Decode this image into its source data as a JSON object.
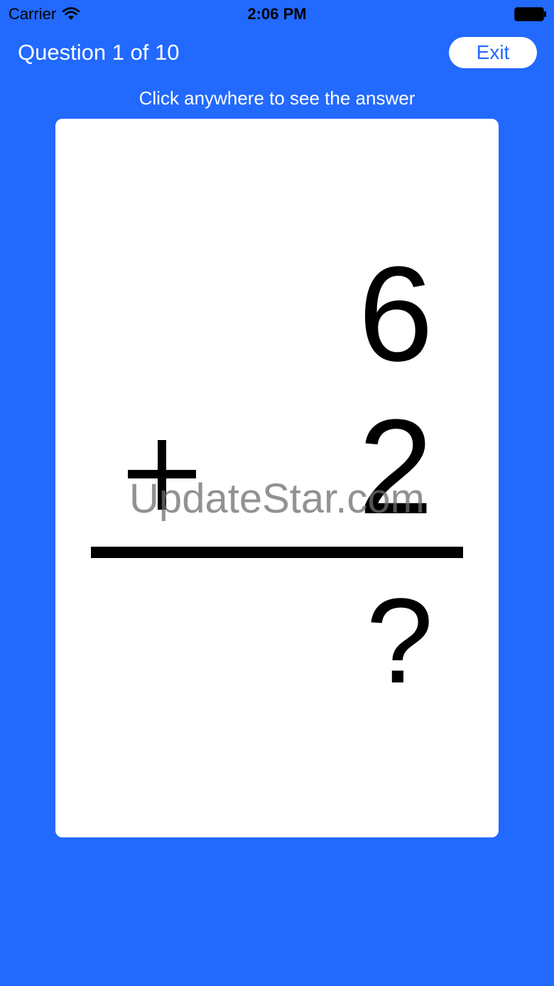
{
  "status_bar": {
    "carrier": "Carrier",
    "time": "2:06 PM",
    "icons": [
      "wifi-icon",
      "battery-icon"
    ]
  },
  "header": {
    "title": "Question 1 of 10",
    "exit_label": "Exit"
  },
  "hint": "Click anywhere to see the answer",
  "card": {
    "top_number": "6",
    "bottom_number": "2",
    "operator": "plus",
    "answer": "?"
  },
  "watermark": "UpdateStar.com",
  "colors": {
    "background": "#2269fe",
    "card": "#ffffff",
    "text_on_background": "#ffffff",
    "button_text": "#2269fe"
  }
}
